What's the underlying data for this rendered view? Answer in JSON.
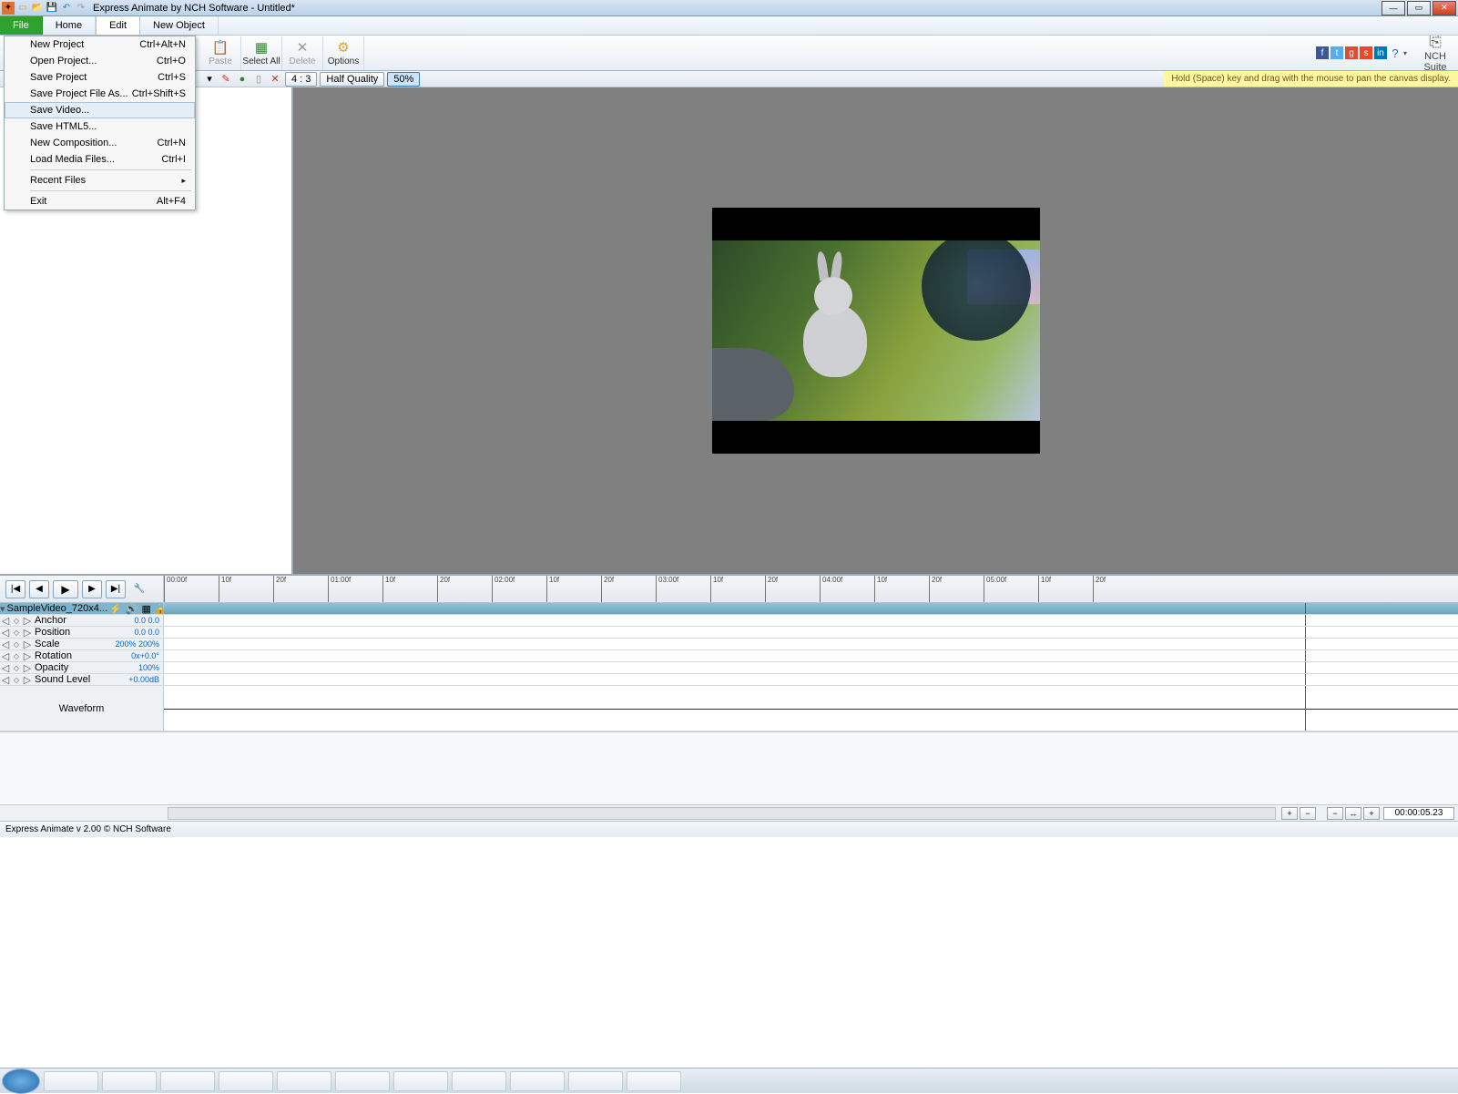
{
  "titlebar": {
    "title": "Express Animate by NCH Software - Untitled*"
  },
  "menubar": {
    "file": "File",
    "home": "Home",
    "edit": "Edit",
    "newobj": "New Object"
  },
  "filemenu": {
    "items": [
      {
        "label": "New Project",
        "shortcut": "Ctrl+Alt+N"
      },
      {
        "label": "Open Project...",
        "shortcut": "Ctrl+O"
      },
      {
        "label": "Save Project",
        "shortcut": "Ctrl+S"
      },
      {
        "label": "Save Project File As...",
        "shortcut": "Ctrl+Shift+S"
      },
      {
        "label": "Save Video...",
        "shortcut": "",
        "hl": true
      },
      {
        "label": "Save HTML5...",
        "shortcut": ""
      },
      {
        "label": "New Composition...",
        "shortcut": "Ctrl+N"
      },
      {
        "label": "Load Media Files...",
        "shortcut": "Ctrl+I"
      },
      {
        "sep": true
      },
      {
        "label": "Recent Files",
        "shortcut": "",
        "sub": true
      },
      {
        "sep": true
      },
      {
        "label": "Exit",
        "shortcut": "Alt+F4"
      }
    ]
  },
  "ribbon": {
    "paste": "Paste",
    "selectall": "Select All",
    "delete": "Delete",
    "options": "Options",
    "suite": "NCH Suite"
  },
  "toolbar2": {
    "aspect": "4 : 3",
    "quality": "Half Quality",
    "zoom": "50%",
    "hint": "Hold (Space) key and drag with the mouse to pan the canvas display."
  },
  "timeline": {
    "ruler": [
      "00:00f",
      "10f",
      "20f",
      "01:00f",
      "10f",
      "20f",
      "02:00f",
      "10f",
      "20f",
      "03:00f",
      "10f",
      "20f",
      "04:00f",
      "10f",
      "20f",
      "05:00f",
      "10f",
      "20f"
    ],
    "clip": "SampleVideo_720x4...",
    "props": [
      {
        "name": "Anchor",
        "val": "0.0  0.0"
      },
      {
        "name": "Position",
        "val": "0.0  0.0"
      },
      {
        "name": "Scale",
        "val": "200%  200%"
      },
      {
        "name": "Rotation",
        "val": "0x+0.0°"
      },
      {
        "name": "Opacity",
        "val": "100%"
      },
      {
        "name": "Sound Level",
        "val": "+0.00dB"
      }
    ],
    "waveform": "Waveform"
  },
  "botbar": {
    "time": "00:00:05.23"
  },
  "status": {
    "text": "Express Animate v 2.00 © NCH Software"
  }
}
